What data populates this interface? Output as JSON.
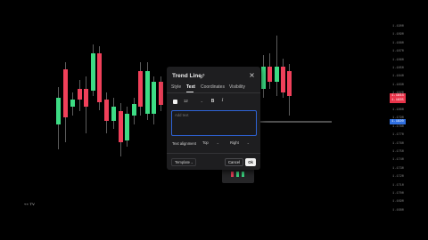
{
  "dialog": {
    "title": "Trend Line",
    "tabs": [
      {
        "label": "Style",
        "active": false
      },
      {
        "label": "Text",
        "active": true
      },
      {
        "label": "Coordinates",
        "active": false
      },
      {
        "label": "Visibility",
        "active": false
      }
    ],
    "text_color": "#f2f2f2",
    "font_size": "12",
    "bold_label": "B",
    "italic_label": "I",
    "text_placeholder": "Add text",
    "text_alignment_label": "Text alignment",
    "vertical_alignment": "Top",
    "horizontal_alignment": "Right",
    "template_label": "Template",
    "cancel_label": "Cancel",
    "ok_label": "Ok"
  },
  "brand_mark": "⌁⌁ TV",
  "price_axis": {
    "ticks": [
      "1.1900",
      "1.1890",
      "1.1880",
      "1.1870",
      "1.1860",
      "1.1850",
      "1.1840",
      "1.1830",
      "1.1820",
      "1.1810",
      "1.1800",
      "1.1790",
      "1.1780",
      "1.1770",
      "1.1760",
      "1.1750",
      "1.1740",
      "1.1730",
      "1.1720",
      "1.1710",
      "1.1700",
      "1.1690",
      "1.1680"
    ],
    "badges": [
      {
        "label": "1.1844",
        "color": "#e8344a"
      },
      {
        "label": "1.1835",
        "color": "#e8344a"
      },
      {
        "label": "1.1820",
        "color": "#2f6fe0"
      }
    ]
  },
  "colors": {
    "up": "#3ddc84",
    "down": "#f0405a",
    "wick": "#9a9a9a"
  }
}
